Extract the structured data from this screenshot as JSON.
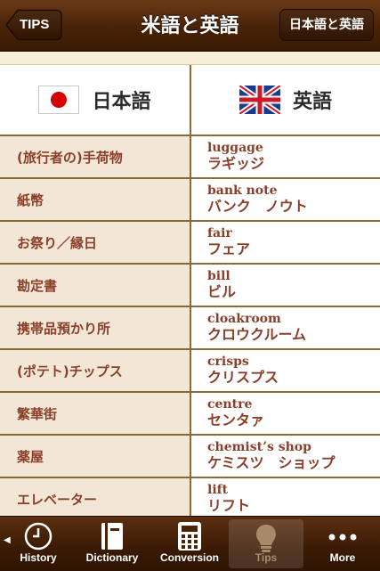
{
  "nav": {
    "title": "米語と英語",
    "back_label": "TIPS",
    "right_label": "日本語と英語"
  },
  "table": {
    "headers": [
      {
        "label": "日本語",
        "flag": "japan-flag-icon"
      },
      {
        "label": "英語",
        "flag": "uk-flag-icon"
      }
    ],
    "rows": [
      {
        "jp": "(旅行者の)手荷物",
        "en": "luggage",
        "kana": "ラギッジ"
      },
      {
        "jp": "紙幣",
        "en": "bank note",
        "kana": "バンク　ノウト"
      },
      {
        "jp": "お祭り／縁日",
        "en": "fair",
        "kana": "フェア"
      },
      {
        "jp": "勘定書",
        "en": "bill",
        "kana": "ビル"
      },
      {
        "jp": "携帯品預かり所",
        "en": "cloakroom",
        "kana": "クロウクルーム"
      },
      {
        "jp": "(ポテト)チップス",
        "en": "crisps",
        "kana": "クリスプス"
      },
      {
        "jp": "繁華街",
        "en": "centre",
        "kana": "センタァ"
      },
      {
        "jp": "薬屋",
        "en": "chemist’s shop",
        "kana": "ケミスツ　ショップ"
      },
      {
        "jp": "エレベーター",
        "en": "lift",
        "kana": "リフト"
      }
    ]
  },
  "tabs": [
    {
      "label": "History",
      "icon": "clock-icon"
    },
    {
      "label": "Dictionary",
      "icon": "book-icon"
    },
    {
      "label": "Conversion",
      "icon": "calculator-icon"
    },
    {
      "label": "Tips",
      "icon": "lightbulb-icon",
      "active": true
    },
    {
      "label": "More",
      "icon": "more-dots-icon"
    }
  ],
  "colors": {
    "accent_brown": "#8a3f2a",
    "row_tint": "#f2e7d7",
    "bar": "#4a2408"
  }
}
